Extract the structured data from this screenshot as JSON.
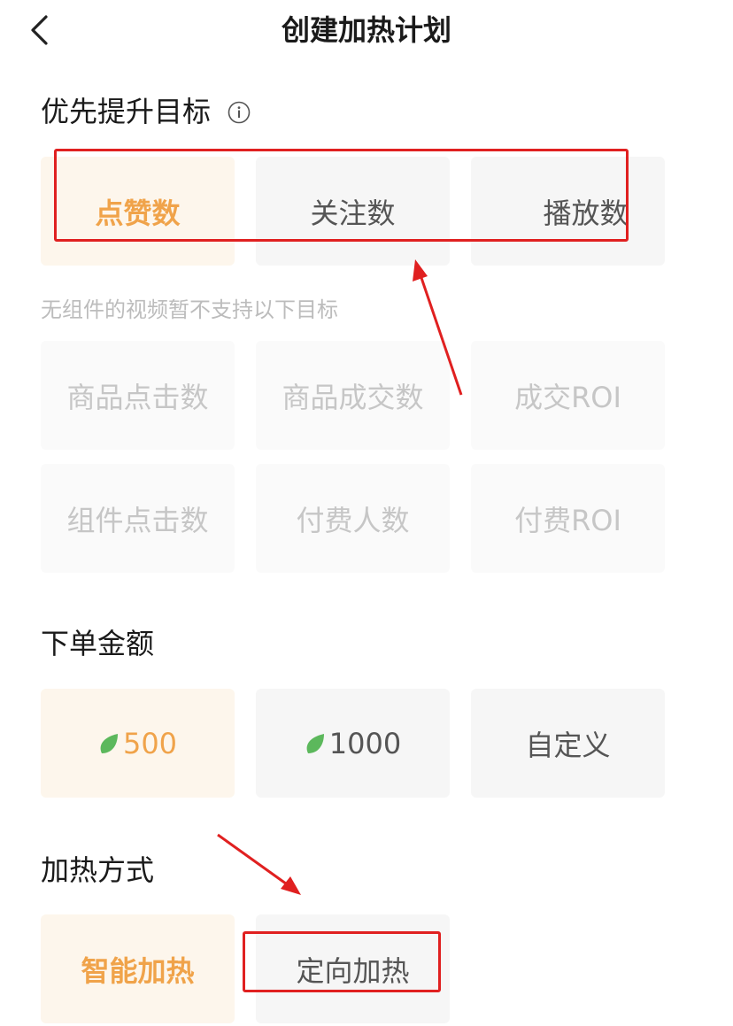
{
  "header": {
    "title": "创建加热计划"
  },
  "goal_section": {
    "title": "优先提升目标",
    "options": [
      "点赞数",
      "关注数",
      "播放数"
    ],
    "selected_index": 0,
    "hint": "无组件的视频暂不支持以下目标",
    "disabled_options": [
      "商品点击数",
      "商品成交数",
      "成交ROI",
      "组件点击数",
      "付费人数",
      "付费ROI"
    ]
  },
  "amount_section": {
    "title": "下单金额",
    "options": [
      "500",
      "1000",
      "自定义"
    ],
    "selected_index": 0
  },
  "method_section": {
    "title": "加热方式",
    "options": [
      "智能加热",
      "定向加热"
    ],
    "selected_index": 0
  },
  "colors": {
    "accent": "#f0a34a",
    "selected_bg": "#fdf6ec",
    "leaf_green": "#5cb85c",
    "annotation_red": "#e02020"
  }
}
